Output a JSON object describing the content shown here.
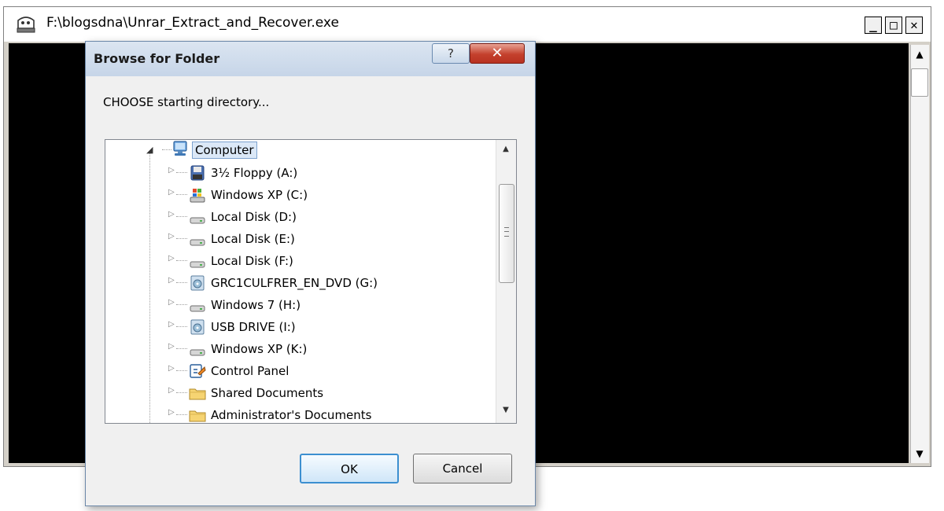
{
  "console_window": {
    "title": "F:\\blogsdna\\Unrar_Extract_and_Recover.exe",
    "controls": {
      "minimize": "_",
      "maximize": "□",
      "close": "✕"
    },
    "scroll": {
      "up": "▲",
      "down": "▼"
    }
  },
  "dialog": {
    "title": "Browse for Folder",
    "help_label": "?",
    "close_label": "✕",
    "prompt": "CHOOSE starting directory...",
    "tree_root": {
      "label": "Computer",
      "expander": "◢",
      "icon": "computer-icon"
    },
    "tree_items": [
      {
        "label": "3½ Floppy (A:)",
        "icon": "floppy-drive-icon"
      },
      {
        "label": "Windows XP (C:)",
        "icon": "windows-drive-icon"
      },
      {
        "label": "Local Disk (D:)",
        "icon": "hard-drive-icon"
      },
      {
        "label": "Local Disk (E:)",
        "icon": "hard-drive-icon"
      },
      {
        "label": "Local Disk (F:)",
        "icon": "hard-drive-icon"
      },
      {
        "label": "GRC1CULFRER_EN_DVD (G:)",
        "icon": "dvd-drive-icon"
      },
      {
        "label": "Windows 7 (H:)",
        "icon": "hard-drive-icon"
      },
      {
        "label": "USB DRIVE (I:)",
        "icon": "usb-drive-icon"
      },
      {
        "label": "Windows XP (K:)",
        "icon": "hard-drive-icon"
      },
      {
        "label": "Control Panel",
        "icon": "control-panel-icon"
      },
      {
        "label": "Shared Documents",
        "icon": "folder-icon"
      },
      {
        "label": "Administrator's Documents",
        "icon": "folder-icon"
      }
    ],
    "expander_glyph": "▷",
    "scroll": {
      "up": "▲",
      "down": "▼"
    },
    "ok_label": "OK",
    "cancel_label": "Cancel"
  }
}
